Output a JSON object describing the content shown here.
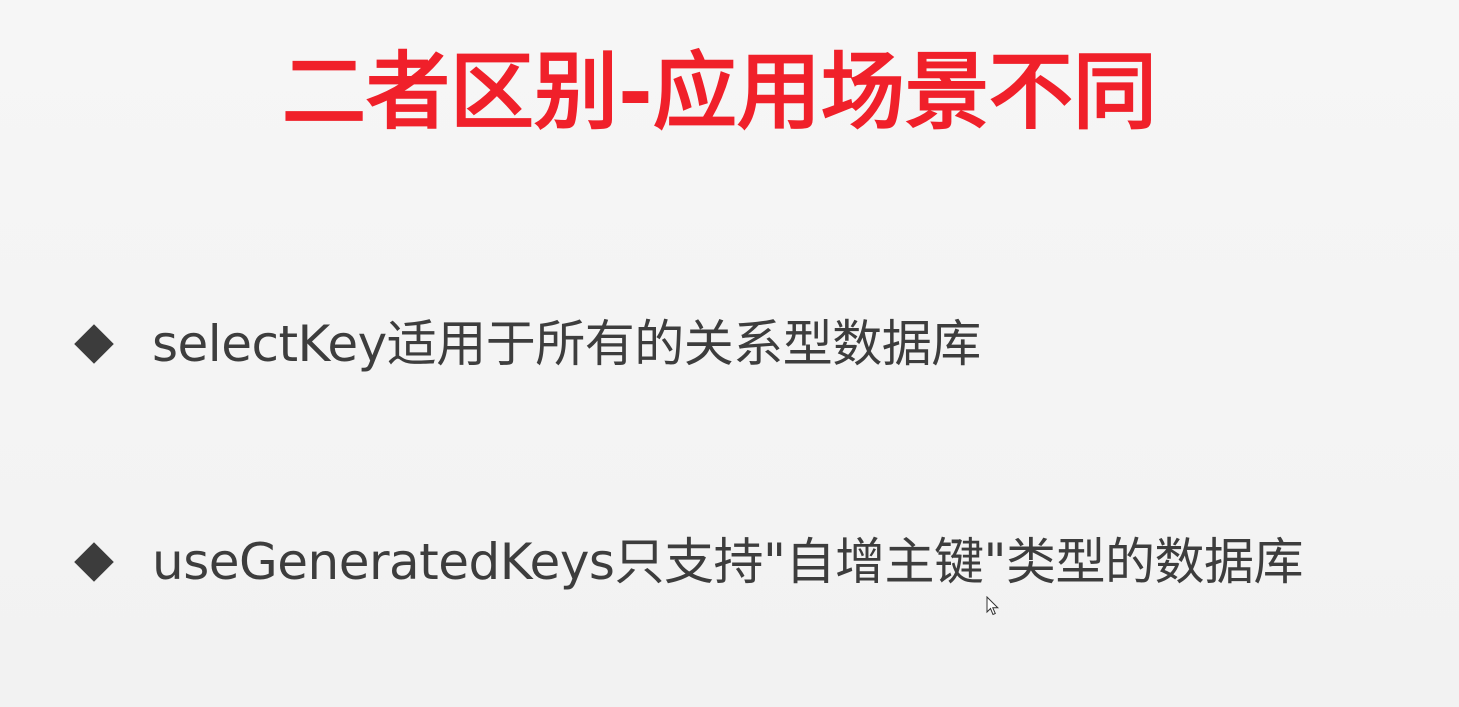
{
  "slide": {
    "title": "二者区别-应用场景不同",
    "bullets": [
      {
        "text": "selectKey适用于所有的关系型数据库",
        "icon": "diamond-bullet-icon"
      },
      {
        "text": "useGeneratedKeys只支持\"自增主键\"类型的数据库",
        "icon": "diamond-bullet-icon"
      }
    ]
  },
  "colors": {
    "title": "#f0202a",
    "text": "#3d3d3d",
    "background": "#f4f4f4"
  },
  "cursor": {
    "icon": "mouse-pointer-icon"
  }
}
